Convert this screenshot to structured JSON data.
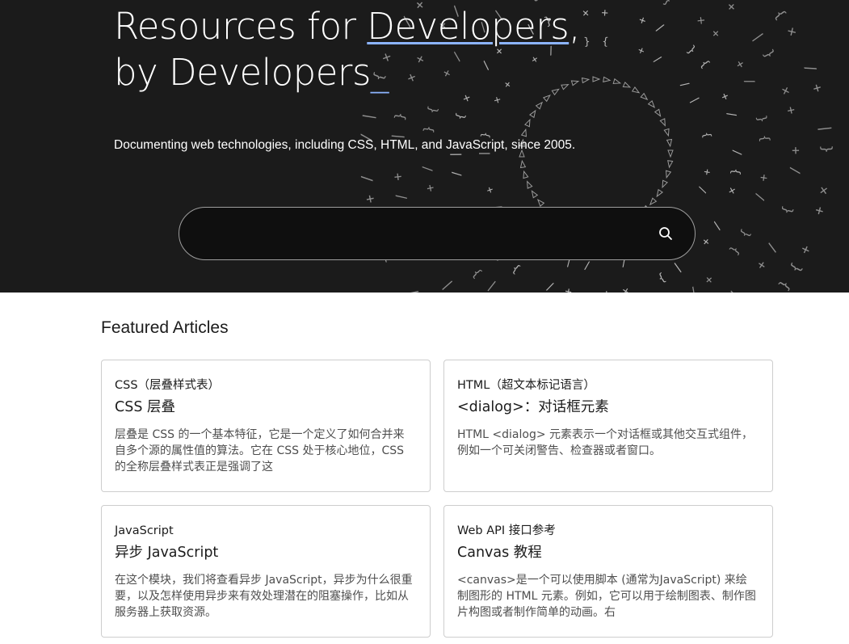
{
  "hero": {
    "title_part1": "Resources for ",
    "title_link": "Developers",
    "title_part2": ",",
    "title_line2": "by Developers",
    "cursor": "_",
    "tagline": "Documenting web technologies, including CSS, HTML, and JavaScript, since 2005.",
    "search": {
      "value": "",
      "placeholder": "",
      "icon": "search-icon"
    },
    "colors": {
      "background": "#1b1b1b",
      "accent": "#8cb4ff"
    }
  },
  "featured": {
    "heading": "Featured Articles",
    "articles": [
      {
        "category": "CSS（层叠样式表）",
        "title": "CSS 层叠",
        "description": "层叠是 CSS 的一个基本特征，它是一个定义了如何合并来自多个源的属性值的算法。它在 CSS 处于核心地位，CSS 的全称层叠样式表正是强调了这"
      },
      {
        "category": "HTML（超文本标记语言）",
        "title": "<dialog>：对话框元素",
        "description": "HTML <dialog> 元素表示一个对话框或其他交互式组件，例如一个可关闭警告、检查器或者窗口。"
      },
      {
        "category": "JavaScript",
        "title": "异步 JavaScript",
        "description": "在这个模块，我们将查看异步 JavaScript，异步为什么很重要，以及怎样使用异步来有效处理潜在的阻塞操作，比如从服务器上获取资源。"
      },
      {
        "category": "Web API 接口参考",
        "title": "Canvas 教程",
        "description": "<canvas>是一个可以使用脚本 (通常为JavaScript) 来绘制图形的 HTML 元素。例如，它可以用于绘制图表、制作图片构图或者制作简单的动画。右"
      }
    ]
  }
}
